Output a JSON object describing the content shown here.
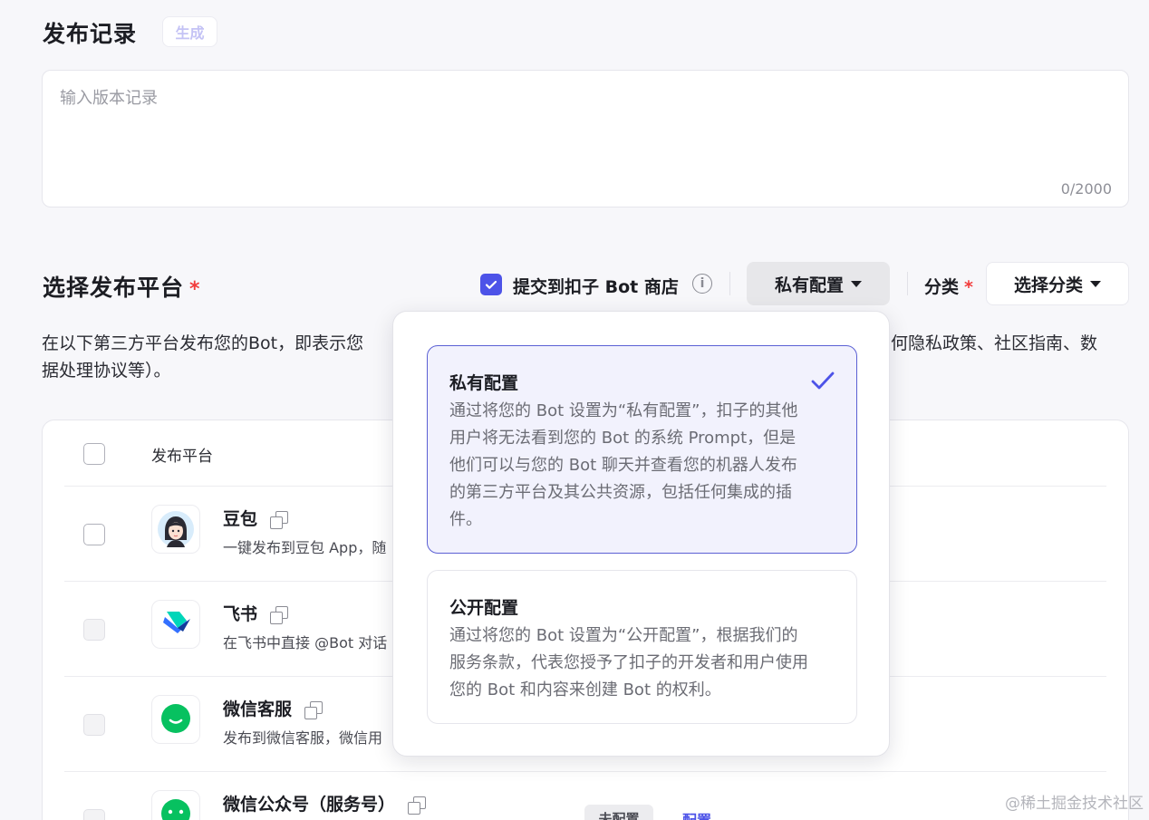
{
  "release": {
    "title": "发布记录",
    "generate_label": "生成",
    "placeholder": "输入版本记录",
    "counter": "0/2000"
  },
  "platform": {
    "title": "选择发布平台",
    "required_mark": "*",
    "submit_label": "提交到扣子 Bot 商店",
    "privacy_selected": "私有配置",
    "category_label": "分类",
    "category_placeholder": "选择分类",
    "desc_line1_left": "在以下第三方平台发布您的Bot，即表示您",
    "desc_line1_right": "何隐私政策、社区指南、数",
    "desc_line2": "据处理协议等）。"
  },
  "table": {
    "header_label": "发布平台",
    "rows": [
      {
        "name": "豆包",
        "desc": "一键发布到豆包 App，随",
        "icon": "doubao-icon",
        "enabled": true
      },
      {
        "name": "飞书",
        "desc": "在飞书中直接 @Bot 对话",
        "icon": "feishu-icon",
        "enabled": false
      },
      {
        "name": "微信客服",
        "desc": "发布到微信客服，微信用",
        "icon": "wechat-icon",
        "enabled": false
      },
      {
        "name": "微信公众号（服务号）",
        "desc": "",
        "icon": "wechat-icon",
        "enabled": false
      }
    ],
    "status_label": "未配置",
    "config_label": "配置"
  },
  "dropdown": {
    "options": [
      {
        "title": "私有配置",
        "desc": "通过将您的 Bot 设置为“私有配置”，扣子的其他用户将无法看到您的 Bot 的系统 Prompt，但是他们可以与您的 Bot 聊天并查看您的机器人发布的第三方平台及其公共资源，包括任何集成的插件。",
        "selected": true
      },
      {
        "title": "公开配置",
        "desc": "通过将您的 Bot 设置为“公开配置”，根据我们的服务条款，代表您授予了扣子的开发者和用户使用您的 Bot 和内容来创建 Bot 的权利。",
        "selected": false
      }
    ]
  },
  "watermark": "@稀土掘金技术社区",
  "colors": {
    "accent": "#4d53e8",
    "required": "#f23c3c",
    "wechat_green": "#07c160"
  }
}
